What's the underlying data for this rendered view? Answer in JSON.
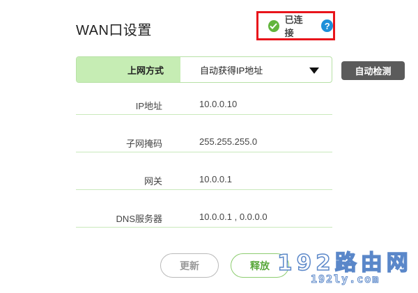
{
  "page": {
    "title": "WAN口设置"
  },
  "status": {
    "text": "已连接",
    "help_icon": "?",
    "indicator_color": "#62b53d",
    "highlight_color": "#e8141b"
  },
  "connection": {
    "label": "上网方式",
    "selected_value": "自动获得IP地址",
    "detect_label": "自动检测"
  },
  "info": [
    {
      "label": "IP地址",
      "value": "10.0.0.10"
    },
    {
      "label": "子网掩码",
      "value": "255.255.255.0"
    },
    {
      "label": "网关",
      "value": "10.0.0.1"
    },
    {
      "label": "DNS服务器",
      "value": "10.0.0.1 , 0.0.0.0"
    }
  ],
  "actions": {
    "renew_label": "更新",
    "release_label": "释放"
  },
  "watermark": {
    "line1": "192路由网",
    "line2": "192ly.com"
  }
}
